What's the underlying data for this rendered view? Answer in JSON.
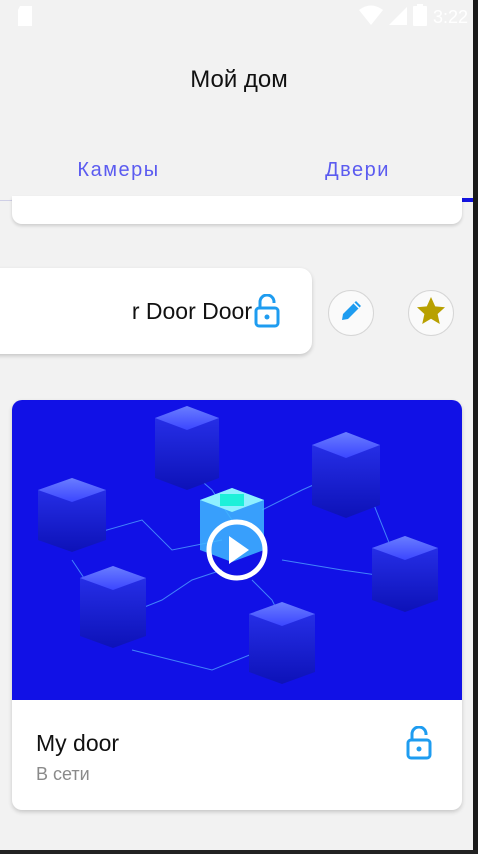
{
  "status_bar": {
    "time": "3:22"
  },
  "app_bar": {
    "title": "Мой дом"
  },
  "tabs": [
    {
      "label": "Камеры",
      "selected": false
    },
    {
      "label": "Двери",
      "selected": true
    }
  ],
  "door_row": {
    "name": "r Door Door",
    "lock_icon": "lock-open-icon",
    "edit_icon": "pencil-icon",
    "favorite_icon": "star-icon"
  },
  "main_card": {
    "name": "My door",
    "status": "В сети",
    "lock_icon": "lock-open-icon",
    "preview_icon": "play-icon"
  },
  "colors": {
    "accent": "#1313e0",
    "tab_text": "#5b5bf0",
    "lock": "#1e9cf0",
    "star": "#b8a000",
    "preview_bg": "#1111e6"
  }
}
